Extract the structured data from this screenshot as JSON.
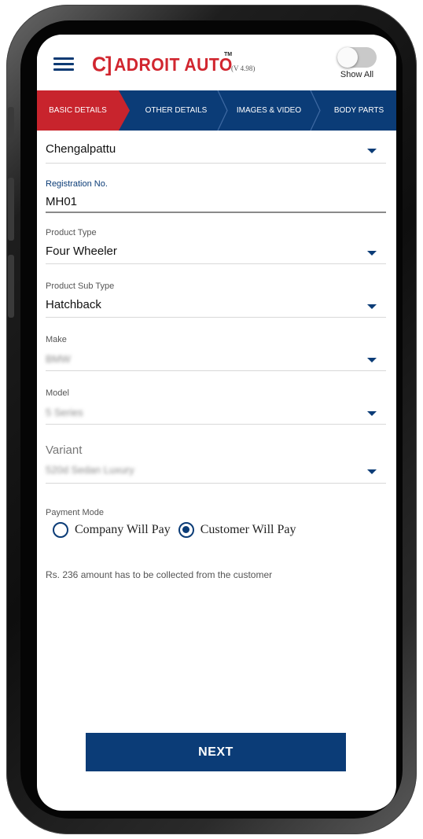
{
  "app": {
    "logo_mark": "C]",
    "logo_text": "ADROIT AUTO",
    "logo_tm": "TM",
    "version": "(V 4.98)",
    "show_all_label": "Show All",
    "show_all_on": false
  },
  "tabs": [
    {
      "label": "BASIC DETAILS",
      "active": true
    },
    {
      "label": "OTHER DETAILS",
      "active": false
    },
    {
      "label": "IMAGES & VIDEO",
      "active": false
    },
    {
      "label": "BODY PARTS",
      "active": false
    }
  ],
  "form": {
    "city": {
      "value": "Chengalpattu"
    },
    "registration": {
      "label": "Registration No.",
      "value": "MH01"
    },
    "product_type": {
      "label": "Product Type",
      "value": "Four Wheeler"
    },
    "product_sub_type": {
      "label": "Product Sub Type",
      "value": "Hatchback"
    },
    "make": {
      "label": "Make",
      "value": "BMW"
    },
    "model": {
      "label": "Model",
      "value": "5 Series"
    },
    "variant": {
      "label": "Variant",
      "value": "520d Sedan Luxury"
    },
    "payment_mode": {
      "label": "Payment Mode",
      "options": [
        "Company Will Pay",
        "Customer Will Pay"
      ],
      "selected": "Customer Will Pay"
    },
    "note": "Rs. 236 amount has to be collected from the customer"
  },
  "actions": {
    "next_label": "NEXT"
  },
  "colors": {
    "primary": "#0b3c77",
    "accent": "#c8242d"
  }
}
